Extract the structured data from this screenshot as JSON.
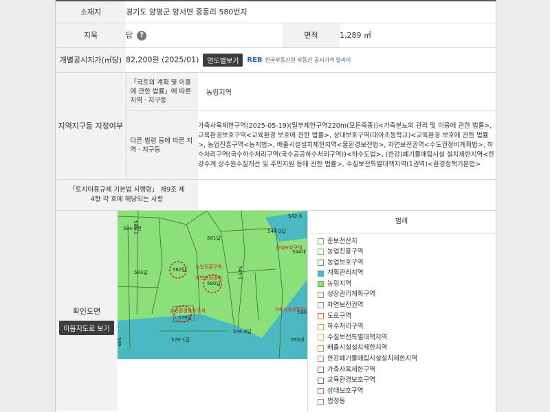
{
  "rows": {
    "location": {
      "label": "소재지",
      "value": "경기도 양평군 양서면 중동리 580번지"
    },
    "jimok": {
      "label": "지목",
      "value": "답",
      "help": "?"
    },
    "area": {
      "label": "면적",
      "value": "1,289 ㎡"
    },
    "price": {
      "label": "개별공시지가(㎡당)",
      "value": "82,200원 (2025/01)",
      "button": "연도별보기",
      "reb_logo": "REB",
      "reb_text": "한국부동산원",
      "reb_text2": "부동산 공시가격",
      "reb_link": "알리미"
    }
  },
  "zoning": {
    "label": "지역지구등 지정여부",
    "national_label": "「국토의 계획 및 이용에 관한 법률」에 따른 지역ㆍ지구등",
    "national_value": "농림지역",
    "other_label": "다른 법령 등에 따른 지역ㆍ지구등",
    "other_value": "가축사육제한구역(2025-05-19)(일부제한구역220m(모든축종))<가축분뇨의 관리 및 이용에 관한 법률>, 교육환경보호구역<교육환경 보호에 관한 법률>, 상대보호구역(대아초등학교)<교육환경 보호에 관한 법률>, 농업진흥구역<농지법>, 배출시설설치제한지역<물환경보전법>, 자연보전권역<수도권정비계획법>, 하수처리구역(국수하수처리구역(국수공공하수처리구역))<하수도법>, (한강)폐기물매립시설 설치제한지역<한강수계 상수원수질개선 및 주민지원 등에 관한 법률>, 수질보전특별대책지역(1권역)<환경정책기본법>"
  },
  "regulation": {
    "label": "「토지이용규제 기본법 시행령」 제9조 제4항 각 호에 해당되는 사항",
    "value": ""
  },
  "confirm": {
    "label": "확인도면",
    "button": "이음지도로 보기"
  },
  "map": {
    "labels": [
      "584-2전",
      "581답",
      "544-3답",
      "542-6",
      "583답",
      "582답",
      "580답",
      "545-1",
      "544대",
      "579답",
      "546-6답",
      "578-1답",
      "555대",
      "586-1",
      "589",
      "586"
    ],
    "zone_labels": [
      "농업진흥구역",
      "자연보전권역",
      "교육환경보호구역",
      "상대보호구역",
      "가축사육제한구역"
    ]
  },
  "legend": {
    "title": "범례",
    "items": [
      {
        "label": "준보전산지",
        "color": "#ffffff"
      },
      {
        "label": "농업진흥구역",
        "color": "#ffffff"
      },
      {
        "label": "농업보호구역",
        "color": "#ffffff"
      },
      {
        "label": "계획관리지역",
        "color": "#4bbac0"
      },
      {
        "label": "농림지역",
        "color": "#8be07a"
      },
      {
        "label": "성장관리계획구역",
        "color": "#ffffff"
      },
      {
        "label": "자연보전권역",
        "color": "#ffffff"
      },
      {
        "label": "도로구역",
        "color": "#ffffff"
      },
      {
        "label": "하수처리구역",
        "color": "#ffffff"
      },
      {
        "label": "수질보전특별대책지역",
        "color": "#ffffff"
      },
      {
        "label": "배출시설설치제한지역",
        "color": "#ffffff"
      },
      {
        "label": "한강폐기물매립시설설치제한지역",
        "color": "#ffffff"
      },
      {
        "label": "가축사육제한구역",
        "color": "#ffffff"
      },
      {
        "label": "교육환경보호구역",
        "color": "#ffffff"
      },
      {
        "label": "상대보호구역",
        "color": "#ffffff"
      },
      {
        "label": "법정동",
        "color": "#ffffff"
      }
    ],
    "borders": [
      "#5cb85c",
      "#7ac943",
      "#5a9e3a",
      "#4bbac0",
      "#6c9e4c",
      "#c08050",
      "#909090",
      "#e07020",
      "#d09060",
      "#d0c060",
      "#a09080",
      "#d08080",
      "#707070",
      "#b040b0",
      "#d06060",
      "#909070"
    ]
  },
  "colors": {
    "header_bg": "#f2f2f2",
    "map_green": "#8be07a",
    "map_teal": "#4bbac0",
    "zone_red": "#d02020"
  }
}
